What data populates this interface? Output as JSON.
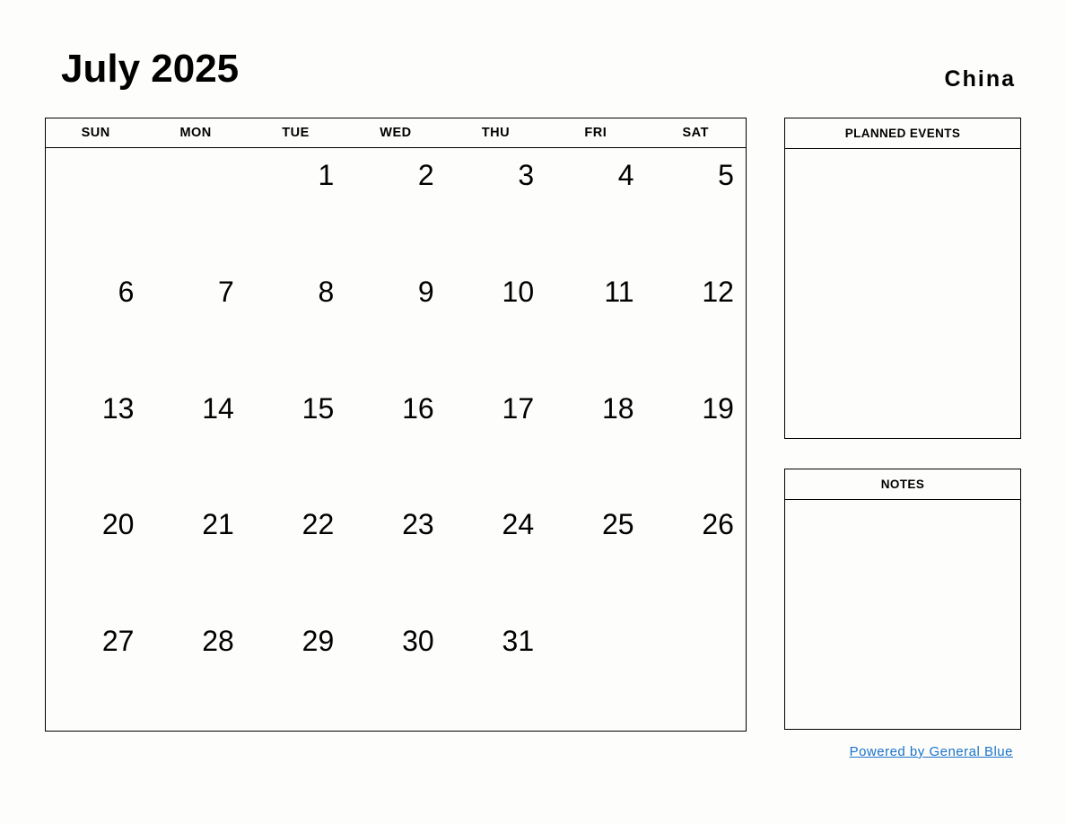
{
  "header": {
    "month_title": "July 2025",
    "locale": "China"
  },
  "calendar": {
    "weekdays": [
      "SUN",
      "MON",
      "TUE",
      "WED",
      "THU",
      "FRI",
      "SAT"
    ],
    "weeks": [
      [
        "",
        "",
        "1",
        "2",
        "3",
        "4",
        "5"
      ],
      [
        "6",
        "7",
        "8",
        "9",
        "10",
        "11",
        "12"
      ],
      [
        "13",
        "14",
        "15",
        "16",
        "17",
        "18",
        "19"
      ],
      [
        "20",
        "21",
        "22",
        "23",
        "24",
        "25",
        "26"
      ],
      [
        "27",
        "28",
        "29",
        "30",
        "31",
        "",
        ""
      ]
    ]
  },
  "panels": {
    "planned_events": {
      "title": "PLANNED EVENTS",
      "content": ""
    },
    "notes": {
      "title": "NOTES",
      "content": ""
    }
  },
  "footer": {
    "link_label": "Powered by General Blue",
    "link_color": "#1a73c8"
  }
}
